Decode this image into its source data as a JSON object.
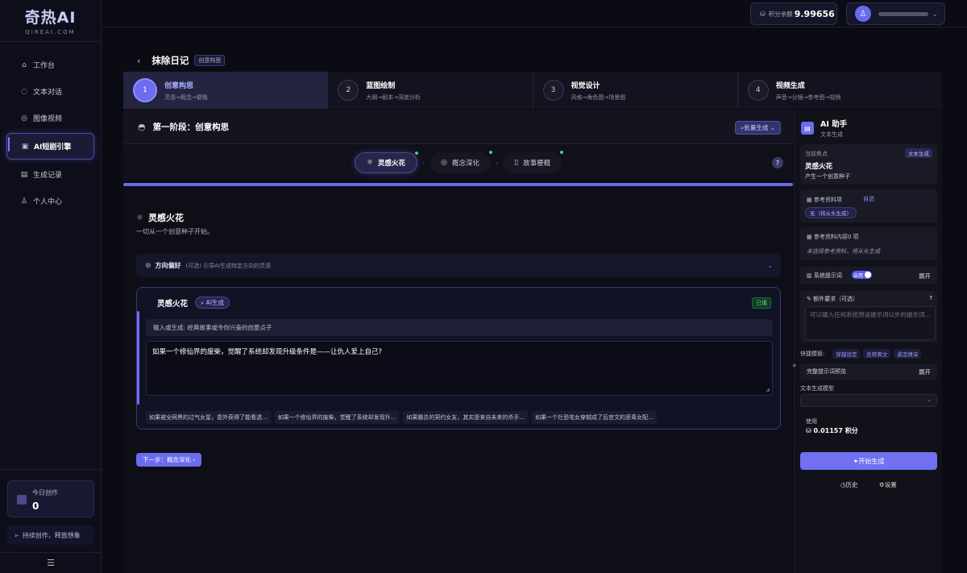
{
  "logo": {
    "brand": "奇热AI",
    "sub": "QIREAI.COM"
  },
  "nav": {
    "items": [
      {
        "label": "工作台",
        "icon": "home-icon"
      },
      {
        "label": "文本对话",
        "icon": "chat-icon"
      },
      {
        "label": "图像视频",
        "icon": "image-icon"
      },
      {
        "label": "AI短剧引擎",
        "icon": "engine-icon",
        "active": true
      },
      {
        "label": "生成记录",
        "icon": "record-icon"
      },
      {
        "label": "个人中心",
        "icon": "user-icon"
      }
    ]
  },
  "sidebar_bottom": {
    "today_label": "今日创作",
    "today_value": "0",
    "slogan": "持续创作，释放想象"
  },
  "topbar": {
    "credit_label": "积分余额",
    "credit_value": "9.99656"
  },
  "page": {
    "title": "抹除日记",
    "tag": "创意构思"
  },
  "steps": [
    {
      "num": "1",
      "name": "创意构思",
      "desc": "灵感→概念→梗概",
      "active": true
    },
    {
      "num": "2",
      "name": "蓝图绘制",
      "desc": "大纲→剧本→深度分析"
    },
    {
      "num": "3",
      "name": "视觉设计",
      "desc": "风格→角色图→场景图"
    },
    {
      "num": "4",
      "name": "视频生成",
      "desc": "声音→分镜→参考图→视频"
    }
  ],
  "stage": {
    "title": "第一阶段：创意构思",
    "batch_btn": "批量生成"
  },
  "subtabs": [
    {
      "label": "灵感火花",
      "active": true
    },
    {
      "label": "概念深化"
    },
    {
      "label": "故事梗概"
    }
  ],
  "section": {
    "title": "灵感火花",
    "desc": "一切从一个创意种子开始。"
  },
  "preference": {
    "label": "方向偏好",
    "desc": "(可选) 引导AI生成特定方向的灵感"
  },
  "spark": {
    "name": "灵感火花",
    "ai_badge": "AI生成",
    "filled_badge": "已填",
    "hint": "输入或生成: 经典故事或令你兴奋的创意点子",
    "value": "如果一个修仙界的废柴，觉醒了系统却发现升级条件是——让仇人爱上自己?",
    "suggestions": [
      "如果被全网黑的过气女星，意外获得了能看透...",
      "如果一个修仙界的废柴，觉醒了系统却发现升...",
      "如果霸总的契约女友，其实是来自未来的杀手...",
      "如果一个社恐宅女穿越成了后宫文的恶毒女配..."
    ]
  },
  "next_btn": "下一步：概念深化",
  "ai_panel": {
    "title": "AI 助手",
    "subtitle": "文本生成",
    "focus_label": "当前焦点",
    "focus_tag": "文本生成",
    "focus_name": "灵感火花",
    "focus_desc": "产生一个创意种子",
    "ref_label": "参考资料项",
    "ref_auto": "自选",
    "ref_value": "无（将从头生成）",
    "refc_label": "参考资料内容0 项",
    "refc_note": "未选择参考资料，将从头生成",
    "sys_label": "系统提示词",
    "sys_toggle": "启用",
    "sys_expand": "展开",
    "extra_label": "额外要求（可选）",
    "extra_placeholder": "可以输入任何系统预设提示词以外的提示词...",
    "quick_label": "快捷模板:",
    "quick_tags": [
      "穿越设定",
      "反转爽文",
      "虐恋情深"
    ],
    "preview_label": "完整提示词预览",
    "preview_expand": "展开",
    "model_label": "文本生成模型",
    "usage_label": "使用",
    "usage_value": "0.01157 积分",
    "gen_btn": "开始生成",
    "history": "历史",
    "settings": "设置"
  }
}
